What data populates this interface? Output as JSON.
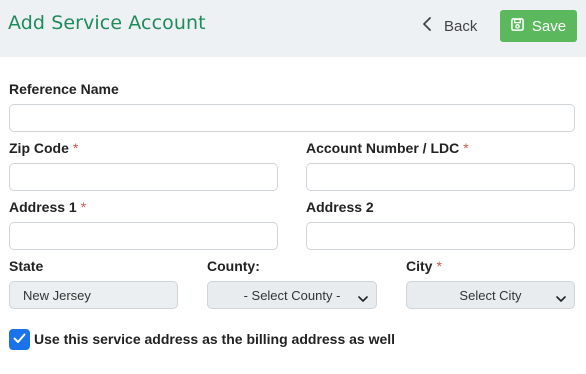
{
  "header": {
    "title": "Add Service Account",
    "back_label": "Back",
    "save_label": "Save"
  },
  "form": {
    "reference_name": {
      "label": "Reference Name",
      "value": ""
    },
    "zip_code": {
      "label": "Zip Code",
      "required_mark": "*",
      "value": ""
    },
    "account_number": {
      "label": "Account Number / LDC",
      "required_mark": "*",
      "value": ""
    },
    "address1": {
      "label": "Address 1",
      "required_mark": "*",
      "value": ""
    },
    "address2": {
      "label": "Address 2",
      "value": ""
    },
    "state": {
      "label": "State",
      "value": "New Jersey"
    },
    "county": {
      "label": "County:",
      "selected": "- Select County -"
    },
    "city": {
      "label": "City",
      "required_mark": "*",
      "selected": "Select City"
    },
    "billing_checkbox": {
      "label": "Use this service address as the billing address as well",
      "checked": true
    }
  },
  "colors": {
    "title": "#1f8a5b",
    "save_button": "#5cb85c",
    "required": "#d9534f",
    "checkbox": "#1a73e8"
  },
  "icons": {
    "back": "chevron-left-icon",
    "save": "floppy-disk-icon",
    "select": "chevron-down-icon",
    "check": "checkmark-icon"
  }
}
